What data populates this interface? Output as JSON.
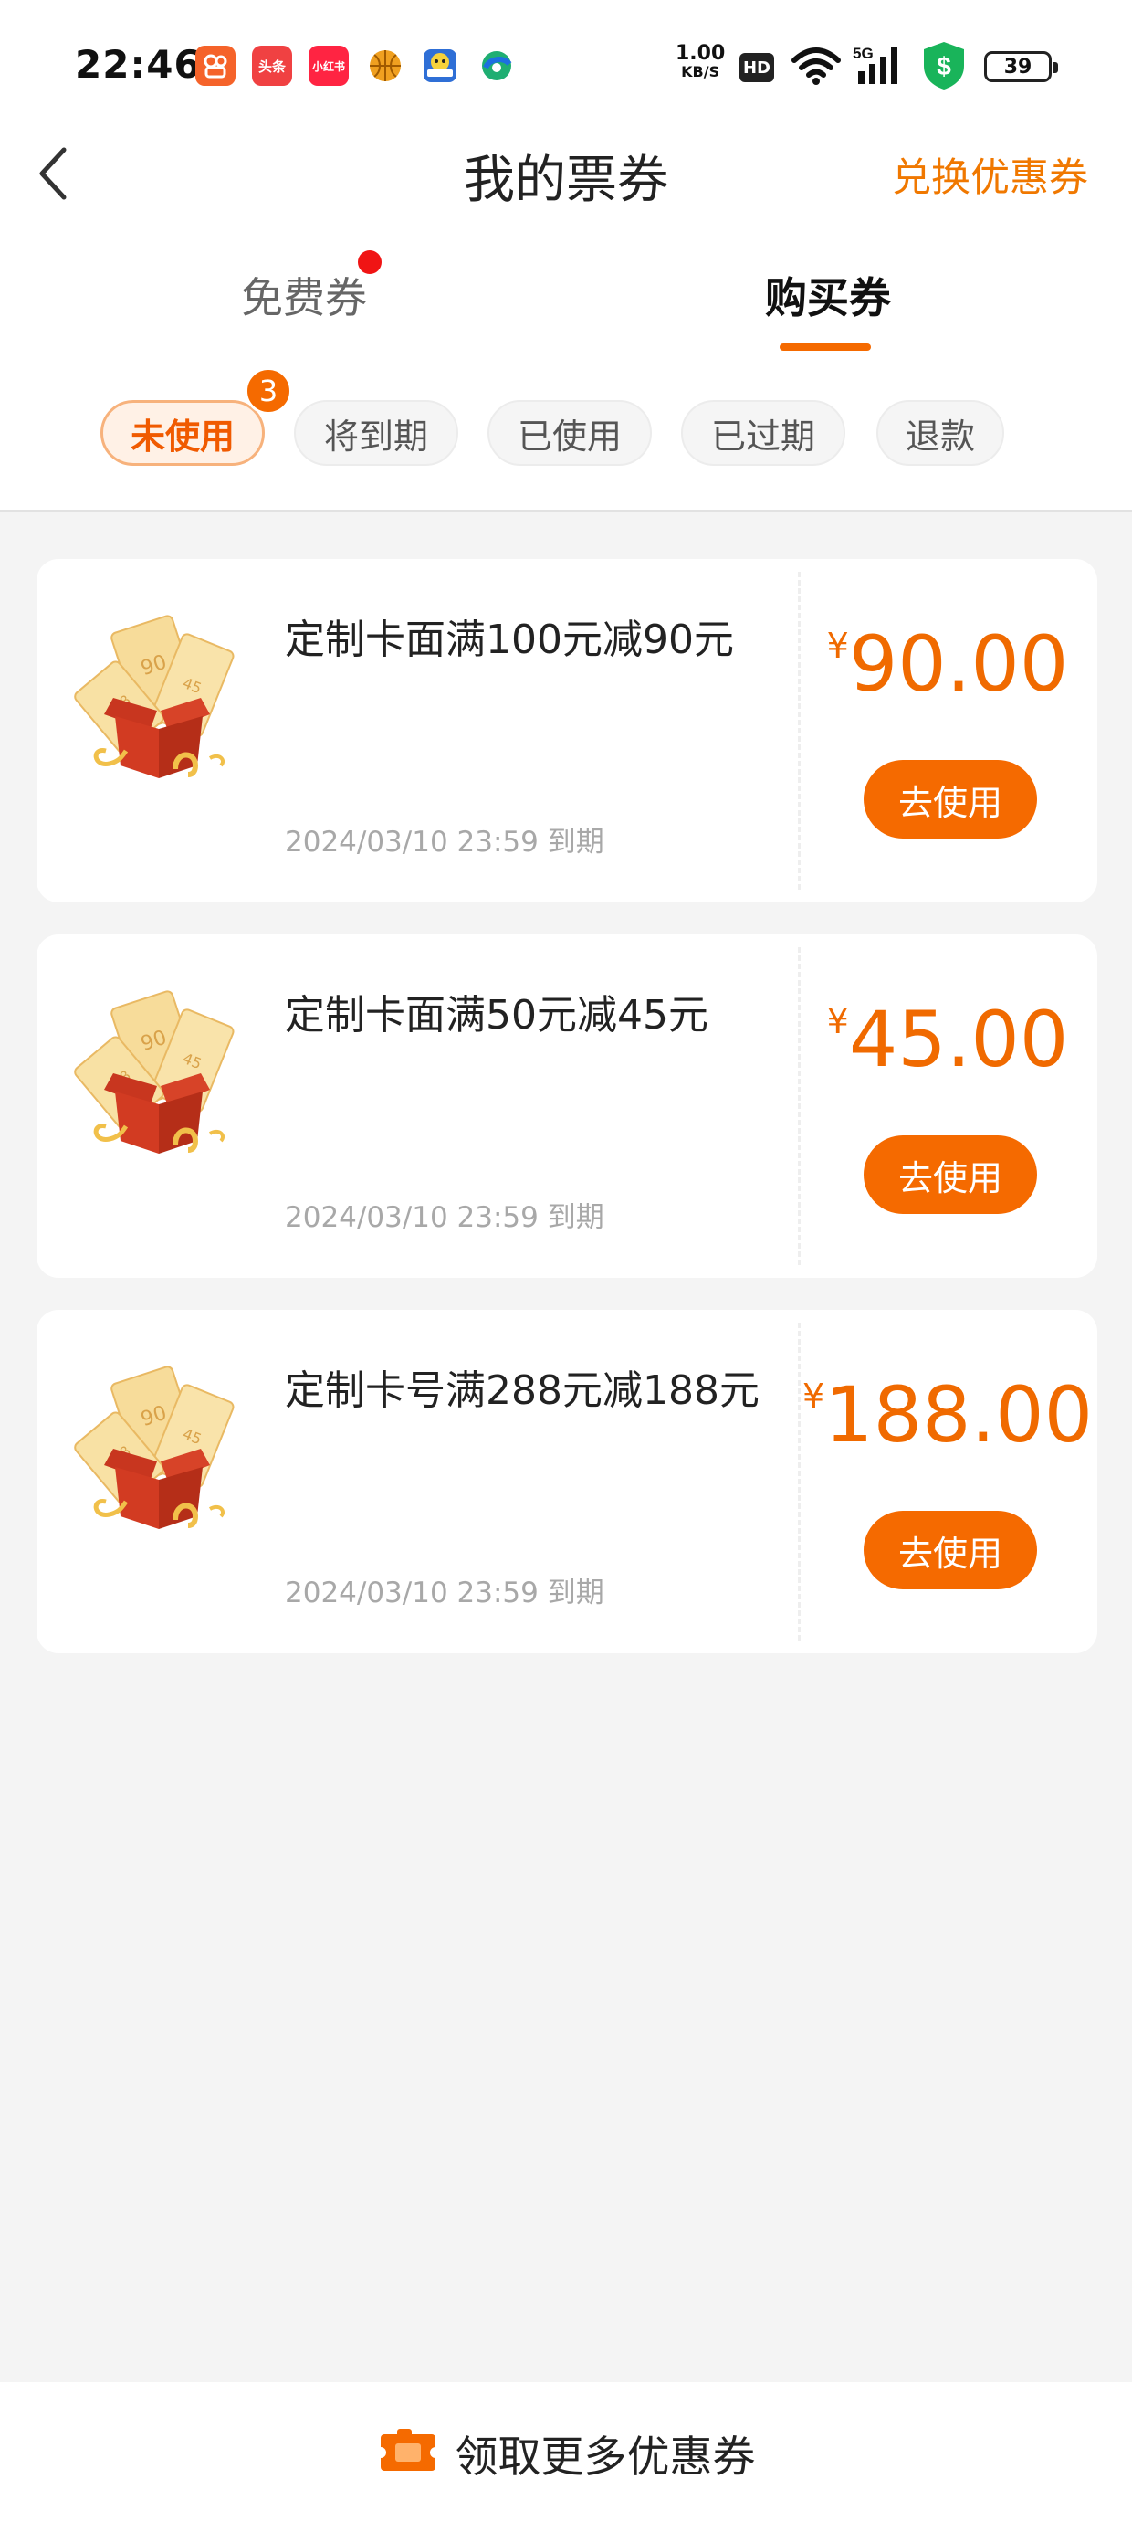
{
  "status_bar": {
    "time": "22:46",
    "apps": [
      {
        "name": "kuaishou-icon",
        "text": "",
        "color": "#f5632a"
      },
      {
        "name": "toutiao-icon",
        "text": "头条",
        "color": "#f04142"
      },
      {
        "name": "xiaohongshu-icon",
        "text": "小红书",
        "color": "#ff2442"
      },
      {
        "name": "basketball-icon",
        "text": "",
        "color": "#f0a020"
      },
      {
        "name": "app-robot-icon",
        "text": "",
        "color": "#2f6fd6"
      },
      {
        "name": "browser-icon",
        "text": "",
        "color": "#1fae72"
      }
    ],
    "net_speed": "1.00",
    "net_unit": "KB/S",
    "hd": "HD",
    "signal": "5G",
    "battery": "39"
  },
  "header": {
    "title": "我的票券",
    "redeem_label": "兑换优惠券",
    "accent": "#f56a00"
  },
  "tabs": [
    {
      "label": "免费券",
      "active": false,
      "has_dot": true
    },
    {
      "label": "购买券",
      "active": true
    }
  ],
  "filters": [
    {
      "label": "未使用",
      "active": true,
      "badge": "3"
    },
    {
      "label": "将到期"
    },
    {
      "label": "已使用"
    },
    {
      "label": "已过期"
    },
    {
      "label": "退款"
    }
  ],
  "coupons": [
    {
      "title": "定制卡面满100元减90元",
      "expiry": "2024/03/10 23:59 到期",
      "currency": "¥",
      "amount": "90.00",
      "button": "去使用"
    },
    {
      "title": "定制卡面满50元减45元",
      "expiry": "2024/03/10 23:59 到期",
      "currency": "¥",
      "amount": "45.00",
      "button": "去使用"
    },
    {
      "title": "定制卡号满288元减188元",
      "expiry": "2024/03/10 23:59 到期",
      "currency": "¥",
      "amount": "188.00",
      "button": "去使用"
    }
  ],
  "bottom": {
    "label": "领取更多优惠券"
  }
}
